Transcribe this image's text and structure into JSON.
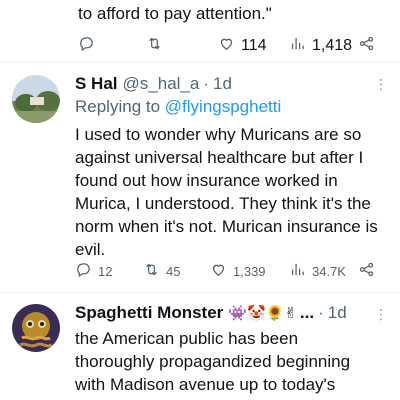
{
  "top_tweet": {
    "text_tail": "to afford to pay attention.\"",
    "likes": "114",
    "views": "1,418"
  },
  "reply1": {
    "name": "S Hal",
    "handle": "@s_hal_a",
    "dot": "·",
    "time": "1d",
    "replying_prefix": "Replying to ",
    "replying_to": "@flyingspghetti",
    "text_lines": [
      "I used to wonder why Muricans are so",
      "against universal healthcare but after I",
      "found out how insurance worked in",
      "Murica, I understood. They think it's the",
      "norm when it's not. Murican insurance is",
      "evil."
    ],
    "replies": "12",
    "reposts": "45",
    "likes": "1,339",
    "views": "34.7K"
  },
  "reply2": {
    "name": "Spaghetti Monster",
    "name_emojis": "👾🤡🌻✌",
    "ellipsis": "...",
    "dot": "·",
    "time": "1d",
    "text_lines": [
      "the American public has been",
      "thoroughly propagandized beginning",
      "with Madison avenue up to today's"
    ]
  },
  "icons": {
    "reply": "reply-icon",
    "repost": "repost-icon",
    "like": "heart-icon",
    "views": "views-icon",
    "share": "share-icon",
    "more": "more-icon"
  },
  "colors": {
    "text": "#0f1419",
    "secondary": "#536471",
    "link": "#1d9bf0",
    "divider": "#eff3f4"
  }
}
